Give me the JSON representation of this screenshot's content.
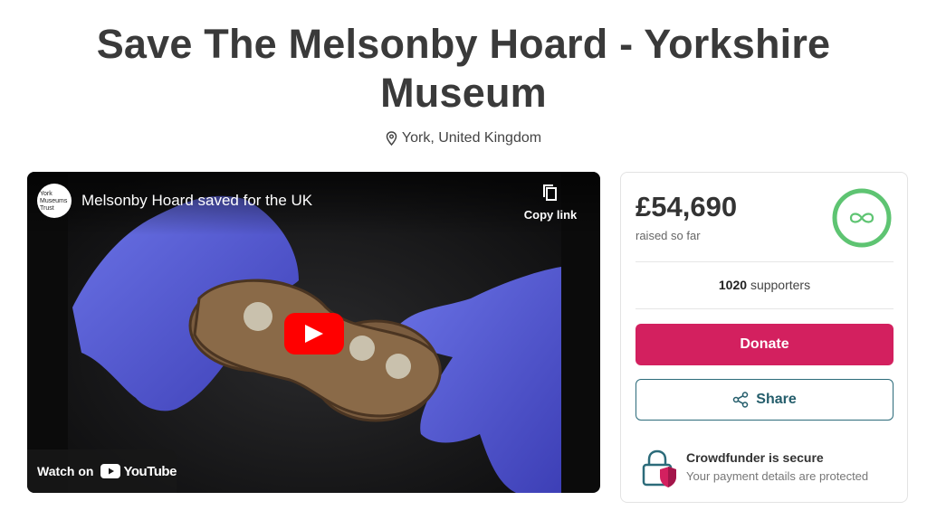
{
  "page": {
    "title_line1": "Save The Melsonby Hoard - Yorkshire",
    "title_line2": "Museum",
    "location": "York, United Kingdom"
  },
  "video": {
    "channel_logo_text": "York Museums Trust",
    "title": "Melsonby Hoard saved for the UK",
    "copy_link_label": "Copy link",
    "watch_on_label": "Watch on",
    "youtube_label": "YouTube"
  },
  "funding": {
    "amount": "£54,690",
    "raised_label": "raised so far",
    "supporters_count": "1020",
    "supporters_label": "supporters",
    "donate_label": "Donate",
    "share_label": "Share",
    "secure_title": "Crowdfunder is secure",
    "secure_subtitle": "Your payment details are protected"
  },
  "colors": {
    "donate": "#d3205f",
    "share_border": "#2c6b7a",
    "progress_ring": "#5ec472",
    "youtube_red": "#ff0000"
  },
  "icons": {
    "location": "map-pin-icon",
    "copy": "copy-icon",
    "play": "play-icon",
    "progress": "infinity-icon",
    "share": "share-icon",
    "secure": "padlock-shield-icon"
  }
}
